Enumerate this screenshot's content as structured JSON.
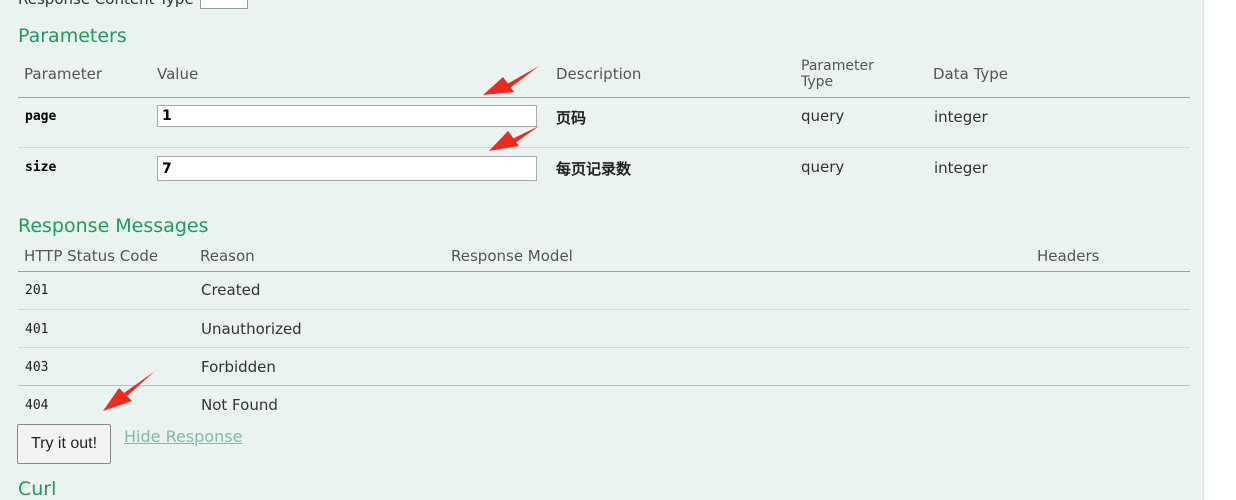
{
  "top_partial": {
    "label": "Response Content Type"
  },
  "parameters": {
    "title": "Parameters",
    "headers": {
      "parameter": "Parameter",
      "value": "Value",
      "description": "Description",
      "parameter_type": "Parameter Type",
      "data_type": "Data Type"
    },
    "rows": [
      {
        "name": "page",
        "value": "1",
        "description": "页码",
        "param_type": "query",
        "data_type": "integer"
      },
      {
        "name": "size",
        "value": "7",
        "description": "每页记录数",
        "param_type": "query",
        "data_type": "integer"
      }
    ]
  },
  "response_messages": {
    "title": "Response Messages",
    "headers": {
      "status_code": "HTTP Status Code",
      "reason": "Reason",
      "model": "Response Model",
      "headers": "Headers"
    },
    "rows": [
      {
        "code": "201",
        "reason": "Created"
      },
      {
        "code": "401",
        "reason": "Unauthorized"
      },
      {
        "code": "403",
        "reason": "Forbidden"
      },
      {
        "code": "404",
        "reason": "Not Found"
      }
    ]
  },
  "actions": {
    "try_label": "Try it out!",
    "hide_label": "Hide Response"
  },
  "bottom_partial": {
    "title": "Curl"
  },
  "colors": {
    "section_title": "#1f9d55",
    "panel_bg": "#ebf3f0",
    "link": "#7dbe9e",
    "annotation_arrow": "#ee2a1f"
  }
}
